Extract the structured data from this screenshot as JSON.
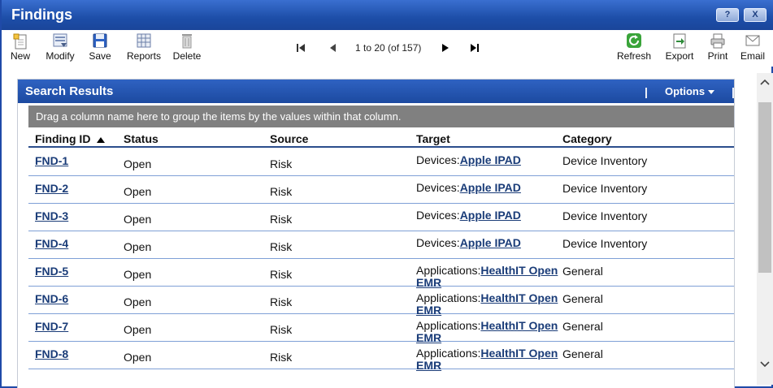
{
  "window": {
    "title": "Findings",
    "help_label": "?",
    "close_label": "X"
  },
  "toolbar": {
    "new": "New",
    "modify": "Modify",
    "save": "Save",
    "reports": "Reports",
    "delete": "Delete",
    "refresh": "Refresh",
    "export": "Export",
    "print": "Print",
    "email": "Email",
    "pager_text": "1 to 20 (of 157)"
  },
  "panel": {
    "title": "Search Results",
    "options_label": "Options",
    "separator": "|",
    "group_hint": "Drag a column name here to group the items by the values within that column."
  },
  "columns": [
    "Finding ID",
    "Status",
    "Source",
    "Target",
    "Category"
  ],
  "rows": [
    {
      "id": "FND-1",
      "status": "Open",
      "source": "Risk",
      "target_prefix": "Devices:",
      "target_link": "Apple IPAD",
      "category": "Device Inventory"
    },
    {
      "id": "FND-2",
      "status": "Open",
      "source": "Risk",
      "target_prefix": "Devices:",
      "target_link": "Apple IPAD",
      "category": "Device Inventory"
    },
    {
      "id": "FND-3",
      "status": "Open",
      "source": "Risk",
      "target_prefix": "Devices:",
      "target_link": "Apple IPAD",
      "category": "Device Inventory"
    },
    {
      "id": "FND-4",
      "status": "Open",
      "source": "Risk",
      "target_prefix": "Devices:",
      "target_link": "Apple IPAD",
      "category": "Device Inventory"
    },
    {
      "id": "FND-5",
      "status": "Open",
      "source": "Risk",
      "target_prefix": "Applications:",
      "target_link": "HealthIT Open EMR",
      "category": "General"
    },
    {
      "id": "FND-6",
      "status": "Open",
      "source": "Risk",
      "target_prefix": "Applications:",
      "target_link": "HealthIT Open EMR",
      "category": "General"
    },
    {
      "id": "FND-7",
      "status": "Open",
      "source": "Risk",
      "target_prefix": "Applications:",
      "target_link": "HealthIT Open EMR",
      "category": "General"
    },
    {
      "id": "FND-8",
      "status": "Open",
      "source": "Risk",
      "target_prefix": "Applications:",
      "target_link": "HealthIT Open EMR",
      "category": "General"
    }
  ],
  "colors": {
    "title_bar": "#1d4ea8",
    "link": "#1a3c78",
    "group_bar": "#808080"
  }
}
